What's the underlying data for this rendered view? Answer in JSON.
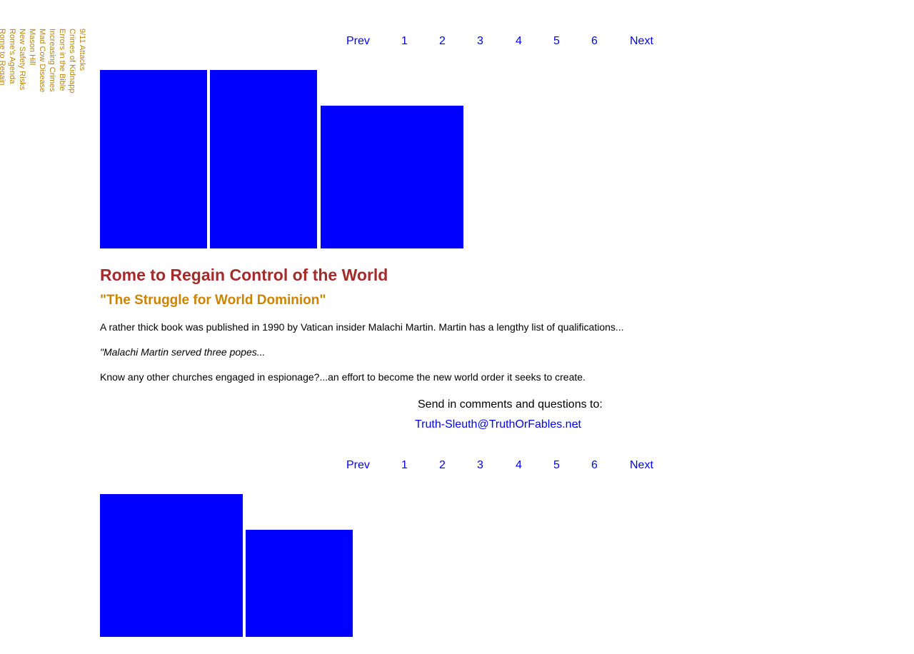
{
  "sidebar": {
    "items": [
      "9/11 Attacks",
      "Crimes of Kidnapping",
      "Errors in the Bible",
      "Increasing Crimes",
      "Mad Cow Disease",
      "Mason Hill",
      "New Safety Risks",
      "Rome's Agenda",
      "Rome to Regain"
    ]
  },
  "pager_top": {
    "prev": "Prev",
    "p1": "1",
    "p2": "2",
    "p3": "3",
    "p4": "4",
    "p5": "5",
    "p6": "6",
    "next": "Next"
  },
  "pager_bottom": {
    "prev": "Prev",
    "p1": "1",
    "p2": "2",
    "p3": "3",
    "p4": "4",
    "p5": "5",
    "p6": "6",
    "next": "Next"
  },
  "article": {
    "title": "Rome to Regain Control of the World",
    "subtitle": "\"The Struggle for World Dominion\"",
    "p1": "A rather thick book was published in 1990 by Vatican insider Malachi Martin. Martin has a lengthy list of qualifications...",
    "p2": "\"Malachi Martin served three popes...",
    "p3": "Know any other churches engaged in espionage?...an effort to become the new world order it seeks to create."
  },
  "contact": {
    "text": "Send in comments and questions to:",
    "email": "Truth-Sleuth@TruthOrFables.net",
    "trailing": "."
  },
  "colors": {
    "link": "#0000ff",
    "title": "#a52a2a",
    "subtitle": "#cc8400",
    "sidebar": "#b8860b",
    "block": "#0000ff"
  }
}
